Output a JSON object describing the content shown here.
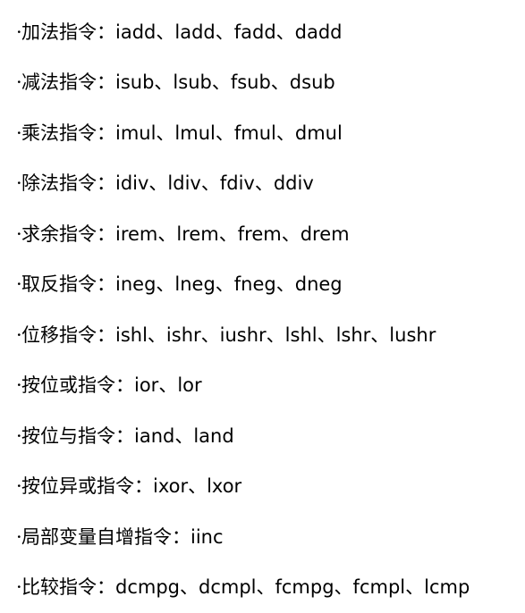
{
  "lines": [
    {
      "bullet": "·",
      "label": "加法指令：",
      "ops": "iadd、ladd、fadd、dadd"
    },
    {
      "bullet": "·",
      "label": "减法指令：",
      "ops": "isub、lsub、fsub、dsub"
    },
    {
      "bullet": "·",
      "label": "乘法指令：",
      "ops": "imul、lmul、fmul、dmul"
    },
    {
      "bullet": "·",
      "label": "除法指令：",
      "ops": "idiv、ldiv、fdiv、ddiv"
    },
    {
      "bullet": "·",
      "label": "求余指令：",
      "ops": "irem、lrem、frem、drem"
    },
    {
      "bullet": "·",
      "label": "取反指令：",
      "ops": "ineg、lneg、fneg、dneg"
    },
    {
      "bullet": "·",
      "label": "位移指令：",
      "ops": "ishl、ishr、iushr、lshl、lshr、lushr"
    },
    {
      "bullet": "·",
      "label": "按位或指令：",
      "ops": "ior、lor"
    },
    {
      "bullet": "·",
      "label": "按位与指令：",
      "ops": "iand、land"
    },
    {
      "bullet": "·",
      "label": "按位异或指令：",
      "ops": "ixor、lxor"
    },
    {
      "bullet": "·",
      "label": "局部变量自增指令：",
      "ops": "iinc"
    },
    {
      "bullet": "·",
      "label": "比较指令：",
      "ops": "dcmpg、dcmpl、fcmpg、fcmpl、lcmp"
    }
  ]
}
